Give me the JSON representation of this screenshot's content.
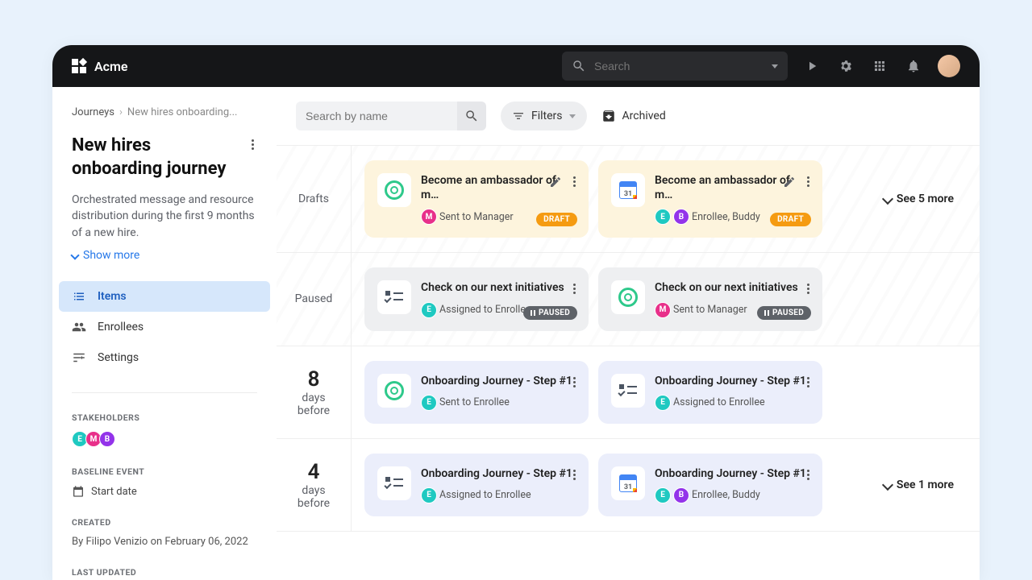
{
  "topbar": {
    "brand": "Acme",
    "search_placeholder": "Search"
  },
  "breadcrumb": {
    "root": "Journeys",
    "current": "New hires onboarding..."
  },
  "journey": {
    "title": "New hires onboarding journey",
    "description": "Orchestrated message and resource distribution during the first 9 months of a new hire.",
    "show_more": "Show more"
  },
  "sidebar_nav": {
    "items_label": "Items",
    "enrollees_label": "Enrollees",
    "settings_label": "Settings"
  },
  "stakeholders": {
    "label": "STAKEHOLDERS",
    "chips": [
      "E",
      "M",
      "B"
    ]
  },
  "baseline": {
    "label": "BASELINE EVENT",
    "value": "Start date"
  },
  "created": {
    "label": "CREATED",
    "text": "By Filipo Venizio on February 06, 2022"
  },
  "last_updated": {
    "label": "LAST UPDATED"
  },
  "toolbar": {
    "search_placeholder": "Search by name",
    "filters": "Filters",
    "archived": "Archived"
  },
  "badges": {
    "draft": "DRAFT",
    "paused": "PAUSED"
  },
  "sections": [
    {
      "label": "Drafts",
      "see_more": "See 5 more",
      "cards": [
        {
          "title": "Become an ambassador of m…",
          "meta": "Sent to Manager",
          "chips": [
            "M"
          ],
          "icon": "target",
          "badge": "draft",
          "edit": true
        },
        {
          "title": "Become an ambassador of m…",
          "meta": "Enrollee, Buddy",
          "chips": [
            "E",
            "B"
          ],
          "icon": "calendar",
          "badge": "draft",
          "edit": true
        }
      ]
    },
    {
      "label": "Paused",
      "cards": [
        {
          "title": "Check on our next initiatives",
          "meta": "Assigned to Enrollee",
          "chips": [
            "E"
          ],
          "icon": "task",
          "badge": "paused"
        },
        {
          "title": "Check on our next initiatives",
          "meta": "Sent to Manager",
          "chips": [
            "M"
          ],
          "icon": "target",
          "badge": "paused"
        }
      ]
    },
    {
      "label_big": "8",
      "label_sub": "days before",
      "cards": [
        {
          "title": "Onboarding Journey - Step #1",
          "meta": "Sent to Enrollee",
          "chips": [
            "E"
          ],
          "icon": "target"
        },
        {
          "title": "Onboarding Journey - Step #1",
          "meta": "Assigned to Enrollee",
          "chips": [
            "E"
          ],
          "icon": "task"
        }
      ]
    },
    {
      "label_big": "4",
      "label_sub": "days before",
      "see_more": "See 1 more",
      "cards": [
        {
          "title": "Onboarding Journey - Step #1",
          "meta": "Assigned to Enrollee",
          "chips": [
            "E"
          ],
          "icon": "task"
        },
        {
          "title": "Onboarding Journey - Step #1",
          "meta": "Enrollee, Buddy",
          "chips": [
            "E",
            "B"
          ],
          "icon": "calendar"
        }
      ]
    }
  ]
}
